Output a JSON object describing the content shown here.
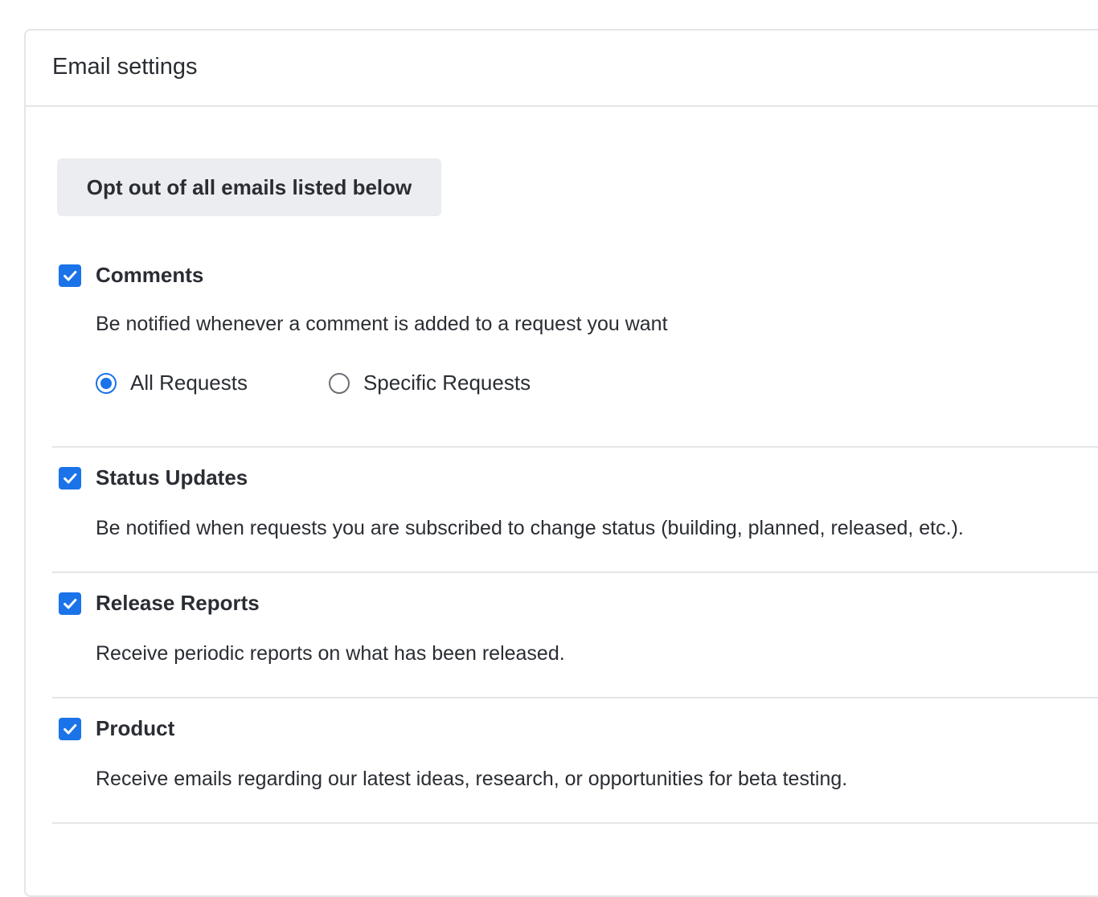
{
  "header": {
    "title": "Email settings"
  },
  "opt_out_button_label": "Opt out of all emails listed below",
  "colors": {
    "accent": "#1a73e8",
    "border": "#e3e5e8",
    "button_bg": "#ebedf0",
    "text": "#2a2d33"
  },
  "sections": [
    {
      "title": "Comments",
      "checked": true,
      "description": "Be notified whenever a comment is added to a request you want",
      "options": [
        {
          "label": "All Requests",
          "selected": true
        },
        {
          "label": "Specific Requests",
          "selected": false
        }
      ]
    },
    {
      "title": "Status Updates",
      "checked": true,
      "description": "Be notified when requests you are subscribed to change status (building, planned, released, etc.)."
    },
    {
      "title": "Release Reports",
      "checked": true,
      "description": "Receive periodic reports on what has been released."
    },
    {
      "title": "Product",
      "checked": true,
      "description": "Receive emails regarding our latest ideas, research, or opportunities for beta testing."
    }
  ]
}
